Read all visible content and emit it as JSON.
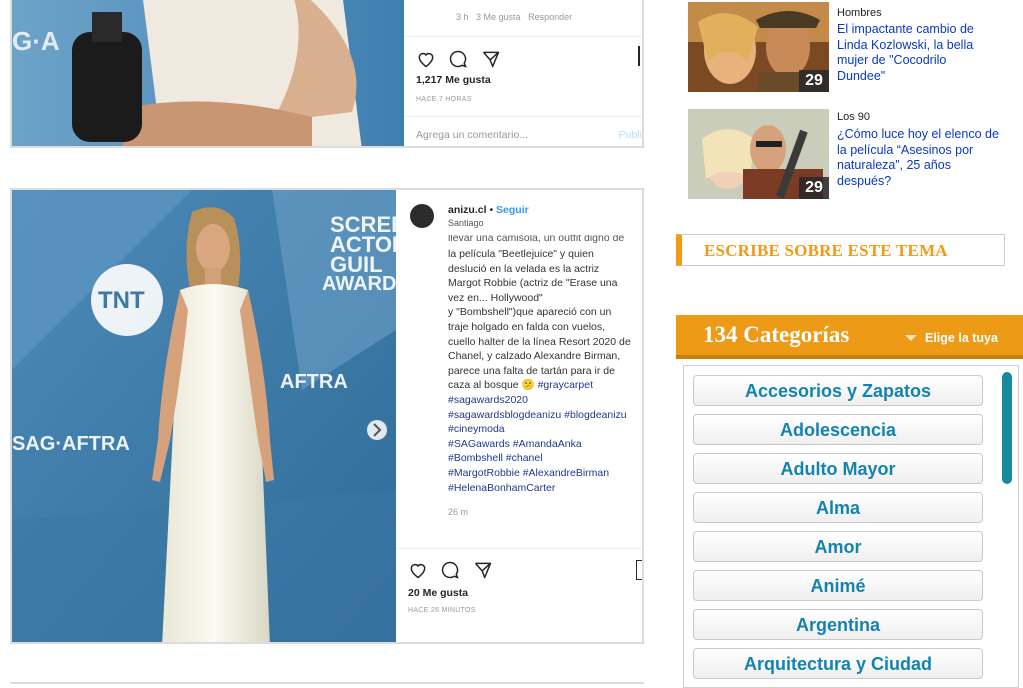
{
  "post1": {
    "comment_meta": {
      "time": "3 h",
      "likes": "3 Me gusta",
      "reply": "Responder"
    },
    "likes": "1,217 Me gusta",
    "ago": "HACE 7 HORAS",
    "comment_placeholder": "Agrega un comentario...",
    "publish": "Publi"
  },
  "post2": {
    "username": "anizu.cl",
    "follow": "Seguir",
    "location": "Santiago",
    "caption_cut": "llevar una camisola, un outfit digno de",
    "caption_lines": [
      "la película \"Beetlejuice\" y quien",
      "deslució en la velada es la actriz",
      "Margot Robbie (actriz de \"Erase una",
      "vez en... Hollywood\"",
      "y \"Bombshell\")que apareció con un",
      "traje holgado en falda con vuelos,",
      "cuello halter de la línea Resort 2020 de",
      "Chanel, y calzado Alexandre Birman,"
    ],
    "caption_emoji_line": "parece una falta de tartán para ir de",
    "caption_emoji_prefix": "caza al bosque",
    "caption_emoji": "😕",
    "caption_emoji_tag": "#graycarpet",
    "hashtags": [
      "#sagawards2020",
      "#sagawardsblogdeanizu #blogdeanizu",
      "#cineymoda",
      "#SAGawards #AmandaAnka",
      "#Bombshell #chanel",
      "#MargotRobbie #AlexandreBirman",
      "#HelenaBonhamCarter"
    ],
    "posted": "26 m",
    "likes": "20 Me gusta",
    "ago": "HACE 26 MINUTOS",
    "photo_texts": {
      "tnt": "TNT",
      "screen": "SCREE",
      "actors": "ACTOR",
      "guild": "GUIL",
      "awards": "AWARD",
      "aftra": "AFTRA",
      "sagaftra": "SAG·AFTRA"
    }
  },
  "post1_photo_text": "G·A",
  "sidebar": {
    "articles": [
      {
        "section": "Hombres",
        "title": "El impactante cambio de Linda Kozlowski, la bella mujer de \"Cocodrilo Dundee\"",
        "count": "29"
      },
      {
        "section": "Los 90",
        "title": "¿Cómo luce hoy el elenco de la película “Asesinos por naturaleza”, 25 años después?",
        "count": "29"
      }
    ],
    "write_label": "ESCRIBE SOBRE ESTE TEMA",
    "categories_title": "134 Categorías",
    "categories_cta": "Elige la tuya",
    "categories": [
      "Accesorios y Zapatos",
      "Adolescencia",
      "Adulto Mayor",
      "Alma",
      "Amor",
      "Animé",
      "Argentina",
      "Arquitectura y Ciudad"
    ]
  },
  "colors": {
    "accent": "#ed9a17",
    "link": "#0a39c4",
    "category_text": "#1583b0",
    "hashtag": "#1f3a8a"
  }
}
